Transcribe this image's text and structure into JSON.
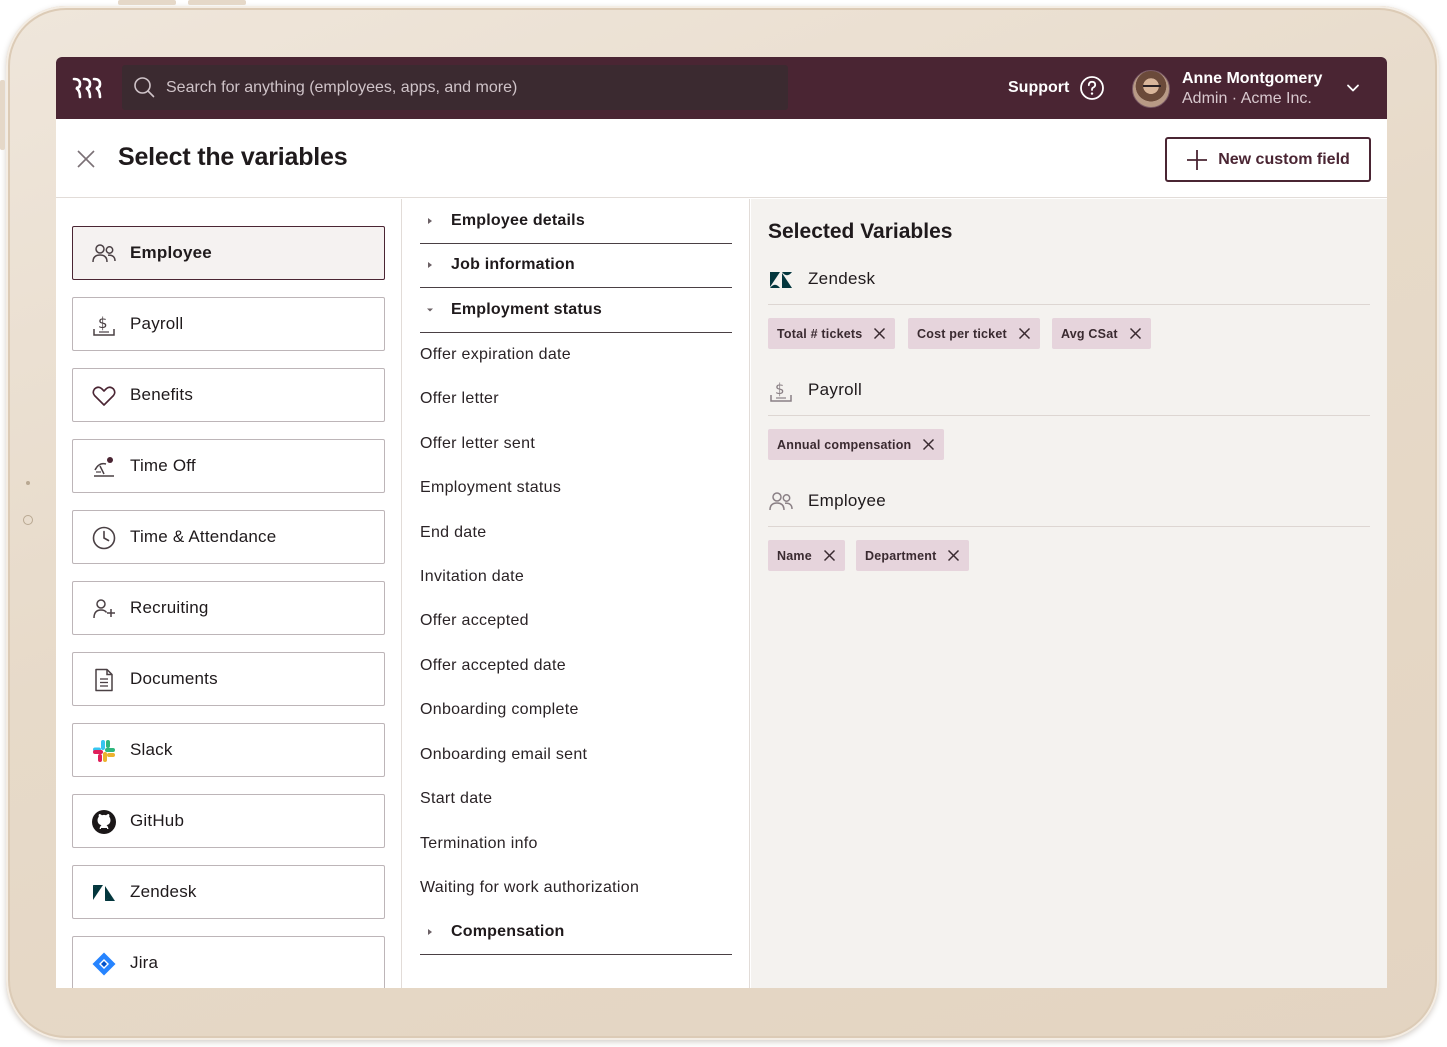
{
  "topbar": {
    "search_placeholder": "Search for anything (employees, apps, and more)",
    "support_label": "Support",
    "user_name": "Anne Montgomery",
    "user_role": "Admin · Acme Inc."
  },
  "header": {
    "title": "Select the variables",
    "new_field_label": "New custom field"
  },
  "categories": [
    {
      "label": "Employee",
      "icon": "people-icon",
      "active": true
    },
    {
      "label": "Payroll",
      "icon": "payroll-icon"
    },
    {
      "label": "Benefits",
      "icon": "heart-icon"
    },
    {
      "label": "Time Off",
      "icon": "beach-icon"
    },
    {
      "label": "Time & Attendance",
      "icon": "clock-icon"
    },
    {
      "label": "Recruiting",
      "icon": "add-person-icon"
    },
    {
      "label": "Documents",
      "icon": "document-icon"
    },
    {
      "label": "Slack",
      "icon": "slack-icon"
    },
    {
      "label": "GitHub",
      "icon": "github-icon"
    },
    {
      "label": "Zendesk",
      "icon": "zendesk-icon"
    },
    {
      "label": "Jira",
      "icon": "jira-icon"
    }
  ],
  "variables": {
    "sections": [
      {
        "label": "Employee details",
        "expanded": false
      },
      {
        "label": "Job information",
        "expanded": false
      },
      {
        "label": "Employment status",
        "expanded": true
      },
      {
        "label": "Compensation",
        "expanded": false
      }
    ],
    "employment_status_items": [
      "Offer expiration date",
      "Offer letter",
      "Offer letter sent",
      "Employment status",
      "End date",
      "Invitation date",
      "Offer accepted",
      "Offer accepted date",
      "Onboarding complete",
      "Onboarding email sent",
      "Start date",
      "Termination info",
      "Waiting for work authorization"
    ]
  },
  "selected": {
    "title": "Selected Variables",
    "groups": [
      {
        "label": "Zendesk",
        "icon": "zendesk-icon",
        "chips": [
          "Total # tickets",
          "Cost per ticket",
          "Avg CSat"
        ]
      },
      {
        "label": "Payroll",
        "icon": "payroll-icon",
        "chips": [
          "Annual compensation"
        ]
      },
      {
        "label": "Employee",
        "icon": "people-icon",
        "chips": [
          "Name",
          "Department"
        ]
      }
    ]
  },
  "colors": {
    "brand": "#4a2533",
    "chip_bg": "#e6d4dc",
    "panel_bg": "#f4f2ef"
  }
}
